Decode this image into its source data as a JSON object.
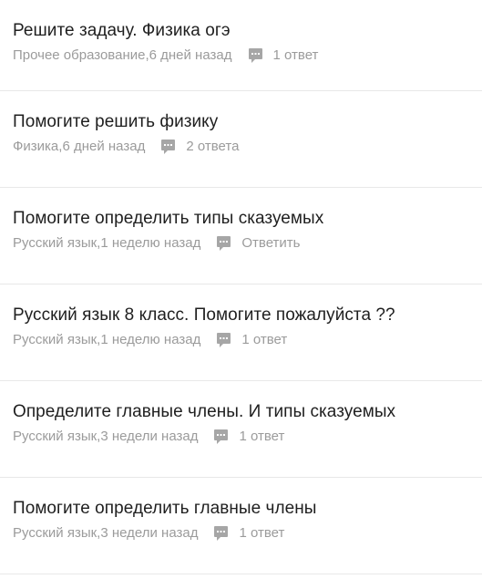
{
  "questions": [
    {
      "title": "Решите задачу. Физика огэ",
      "category": "Прочее образование",
      "time": "6 дней назад",
      "answers": "1 ответ"
    },
    {
      "title": "Помогите решить физику",
      "category": "Физика",
      "time": "6 дней назад",
      "answers": "2 ответа"
    },
    {
      "title": "Помогите определить типы сказуемых",
      "category": "Русский язык",
      "time": "1 неделю назад",
      "answers": "Ответить"
    },
    {
      "title": "Русский язык 8 класс. Помогите пожалуйста ??",
      "category": "Русский язык",
      "time": "1 неделю назад",
      "answers": "1 ответ"
    },
    {
      "title": "Определите главные члены. И типы сказуемых",
      "category": "Русский язык",
      "time": "3 недели назад",
      "answers": "1 ответ"
    },
    {
      "title": "Помогите определить главные члены",
      "category": "Русский язык",
      "time": "3 недели назад",
      "answers": "1 ответ"
    }
  ],
  "meta_separator": ", ",
  "icons": {
    "answers_icon": "comment-bubble-icon"
  },
  "colors": {
    "title": "#1f1f1f",
    "meta": "#9b9b9b",
    "icon": "#a6a6a6",
    "divider": "#e8e8e8"
  }
}
